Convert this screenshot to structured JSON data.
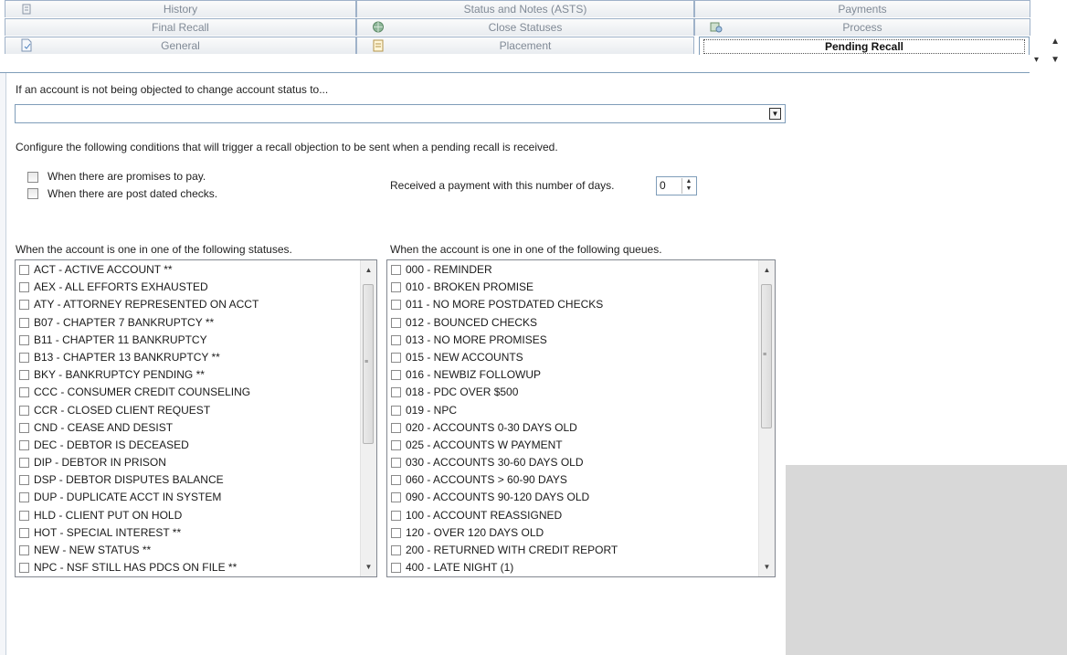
{
  "tabs": {
    "row1": [
      {
        "label": "History",
        "icon": "history-icon"
      },
      {
        "label": "Status and Notes (ASTS)",
        "icon": ""
      },
      {
        "label": "Payments",
        "icon": ""
      }
    ],
    "row2": [
      {
        "label": "Final Recall",
        "icon": ""
      },
      {
        "label": "Close Statuses",
        "icon": "globe-icon"
      },
      {
        "label": "Process",
        "icon": "process-icon"
      }
    ],
    "row3": [
      {
        "label": "General",
        "icon": "document-icon"
      },
      {
        "label": "Placement",
        "icon": "placement-icon"
      },
      {
        "label": "Pending Recall",
        "icon": "",
        "active": true
      }
    ]
  },
  "form": {
    "status_prompt": "If an account is not being objected to change account status to...",
    "status_value": "",
    "conditions_prompt": "Configure the following conditions that will trigger a recall objection to be sent when a pending recall is received.",
    "promises_label": "When there are promises to pay.",
    "promises_checked": false,
    "pdc_label": "When there are post dated checks.",
    "pdc_checked": false,
    "payment_days_label": "Received a payment with this number of days.",
    "payment_days_value": "0"
  },
  "statuses": {
    "header": "When the account is one in one of the following statuses.",
    "items": [
      "ACT - ACTIVE ACCOUNT **",
      "AEX - ALL EFFORTS EXHAUSTED",
      "ATY - ATTORNEY REPRESENTED ON ACCT",
      "B07 - CHAPTER 7 BANKRUPTCY **",
      "B11 - CHAPTER 11 BANKRUPTCY",
      "B13 - CHAPTER 13 BANKRUPTCY **",
      "BKY - BANKRUPTCY PENDING **",
      "CCC - CONSUMER CREDIT COUNSELING",
      "CCR - CLOSED CLIENT REQUEST",
      "CND - CEASE AND DESIST",
      "DEC - DEBTOR IS DECEASED",
      "DIP - DEBTOR IN PRISON",
      "DSP - DEBTOR DISPUTES BALANCE",
      "DUP - DUPLICATE ACCT IN SYSTEM",
      "HLD - CLIENT PUT ON HOLD",
      "HOT - SPECIAL INTEREST **",
      "NEW - NEW STATUS **",
      "NPC - NSF STILL HAS PDCS ON FILE **"
    ]
  },
  "queues": {
    "header": "When the account is one in one of the following queues.",
    "items": [
      "000 - REMINDER",
      "010 - BROKEN PROMISE",
      "011 - NO MORE POSTDATED CHECKS",
      "012 - BOUNCED CHECKS",
      "013 - NO MORE PROMISES",
      "015 - NEW ACCOUNTS",
      "016 - NEWBIZ FOLLOWUP",
      "018 - PDC OVER $500",
      "019 - NPC",
      "020 - ACCOUNTS 0-30 DAYS OLD",
      "025 - ACCOUNTS  W PAYMENT",
      "030 - ACCOUNTS 30-60 DAYS OLD",
      "060 - ACCOUNTS > 60-90 DAYS",
      "090 - ACCOUNTS  90-120 DAYS OLD",
      "100 - ACCOUNT REASSIGNED",
      "120 - OVER 120 DAYS OLD",
      "200 - RETURNED WITH CREDIT REPORT",
      "400 - LATE NIGHT (1)"
    ]
  }
}
